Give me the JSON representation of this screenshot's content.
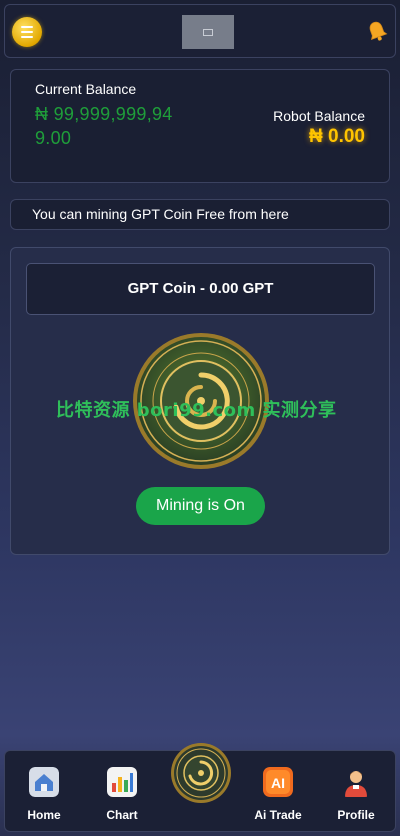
{
  "header": {
    "menu_icon": "hamburger-menu-icon",
    "logo_icon": "broken-image-icon",
    "notification_icon": "bell-icon"
  },
  "balance": {
    "current_label": "Current Balance",
    "current_value": "₦ 99,999,999,949.00",
    "robot_label": "Robot Balance",
    "robot_value": "₦ 0.00"
  },
  "notice": {
    "text": "You can mining GPT Coin Free from here"
  },
  "mining": {
    "coin_title": "GPT Coin - 0.00 GPT",
    "coin_image": "gpt-coin-icon",
    "button_label": "Mining is On"
  },
  "watermark": {
    "text": "比特资源 bori99.com 实测分享"
  },
  "nav": {
    "items": [
      {
        "label": "Home",
        "icon": "home-icon"
      },
      {
        "label": "Chart",
        "icon": "chart-icon"
      },
      {
        "label": "Ai Trade",
        "icon": "ai-icon"
      },
      {
        "label": "Profile",
        "icon": "profile-icon"
      }
    ],
    "center_icon": "gpt-coin-icon"
  },
  "colors": {
    "current_balance": "#1f9e3a",
    "robot_balance": "#ffc400",
    "mining_button": "#1aa54a",
    "watermark": "#2fbf5a"
  }
}
